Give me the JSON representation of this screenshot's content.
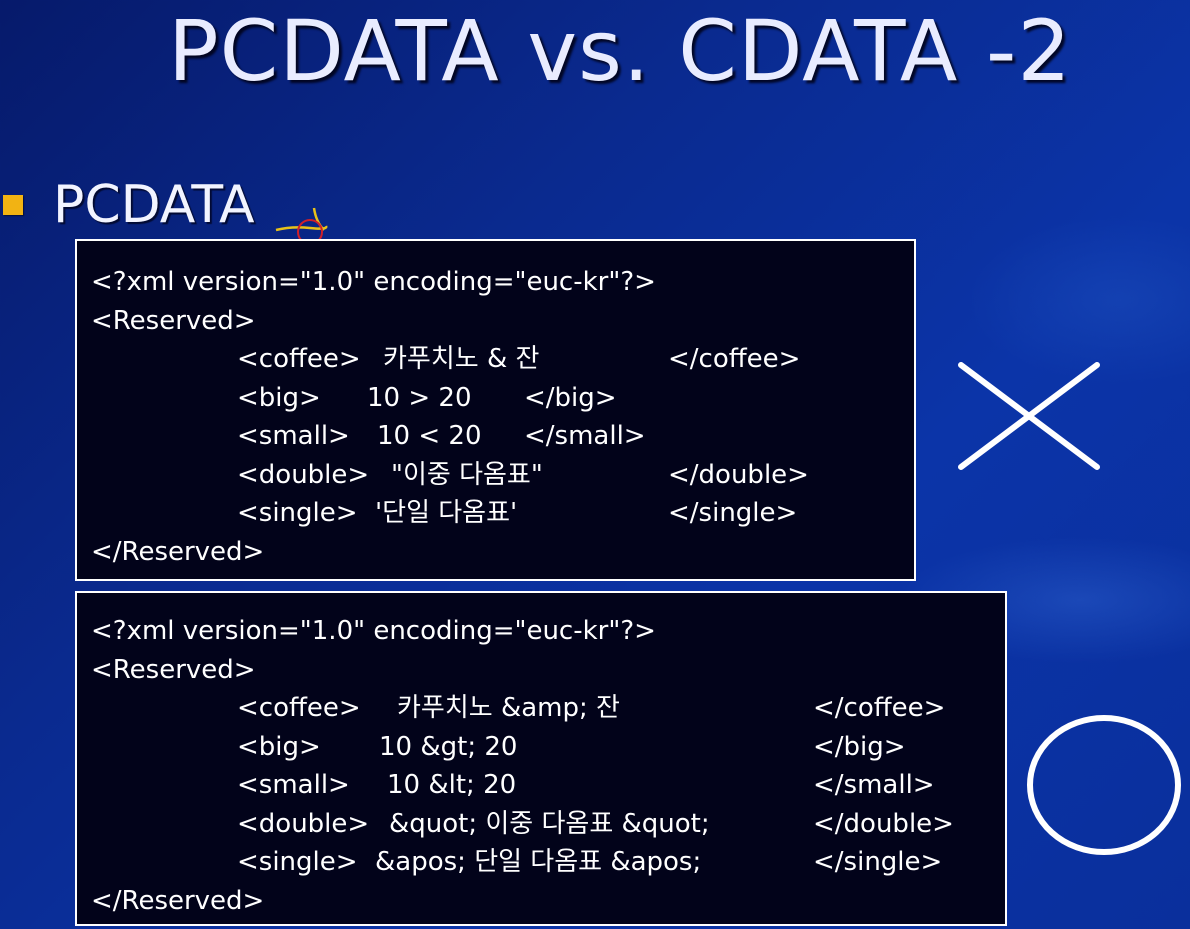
{
  "slide": {
    "title": "PCDATA vs. CDATA -2",
    "bullet": "PCDATA"
  },
  "colors": {
    "background": "#0a2f9c",
    "bullet": "#f2b313",
    "code_background": "#02031a",
    "text": "#ffffff"
  },
  "example_invalid": {
    "mark": "x-mark-icon",
    "lines": [
      {
        "a": "<?xml version=\"1.0\" encoding=\"euc-kr\"?>",
        "b": "",
        "c": ""
      },
      {
        "a": "<Reserved>",
        "b": "",
        "c": ""
      },
      {
        "a": "<coffee>",
        "b": "카푸치노 & 잔",
        "c": "</coffee>"
      },
      {
        "a": "<big>",
        "b": "10 > 20",
        "c": "</big>"
      },
      {
        "a": "<small>",
        "b": "10 < 20",
        "c": "</small>"
      },
      {
        "a": "<double>",
        "b": "\"이중 다옴표\"",
        "c": "</double>"
      },
      {
        "a": "<single>",
        "b": "'단일 다옴표'",
        "c": "</single>"
      },
      {
        "a": "</Reserved>",
        "b": "",
        "c": ""
      }
    ]
  },
  "example_valid": {
    "mark": "circle-mark-icon",
    "lines": [
      {
        "a": "<?xml version=\"1.0\" encoding=\"euc-kr\"?>",
        "b": "",
        "c": ""
      },
      {
        "a": "<Reserved>",
        "b": "",
        "c": ""
      },
      {
        "a": "<coffee>",
        "b": "카푸치노 &amp; 잔",
        "c": "</coffee>"
      },
      {
        "a": "<big>",
        "b": "10 &gt; 20",
        "c": "</big>"
      },
      {
        "a": "<small>",
        "b": "10 &lt; 20",
        "c": "</small>"
      },
      {
        "a": "<double>",
        "b": "&quot; 이중 다옴표 &quot;",
        "c": "</double>"
      },
      {
        "a": "<single>",
        "b": "&apos; 단일 다옴표 &apos;",
        "c": "</single>"
      },
      {
        "a": "</Reserved>",
        "b": "",
        "c": ""
      }
    ]
  }
}
